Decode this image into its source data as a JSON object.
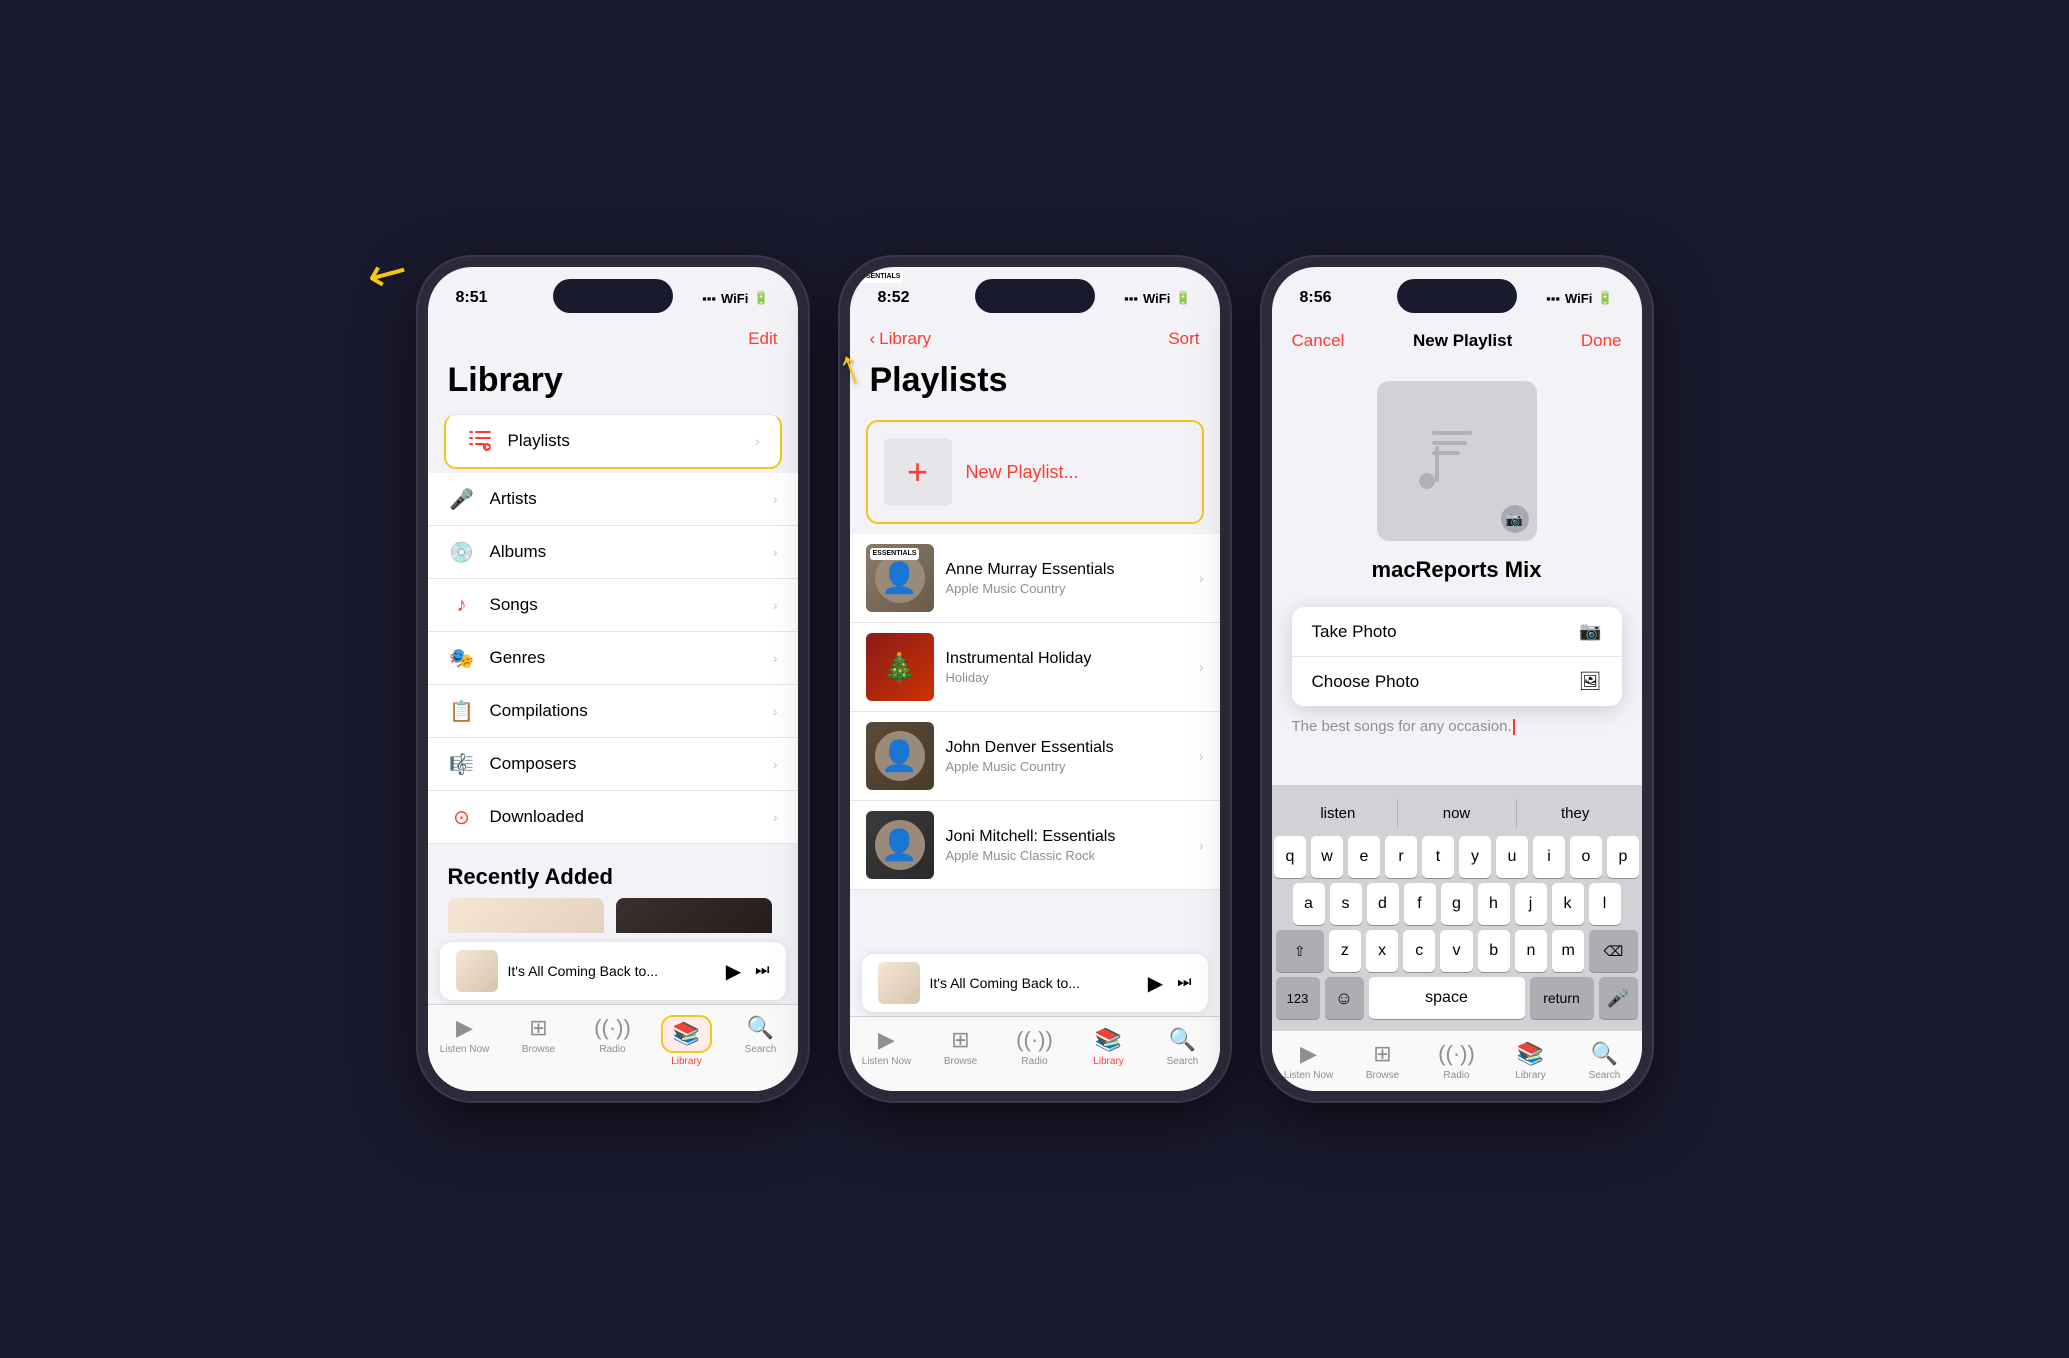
{
  "phone1": {
    "status_time": "8:51",
    "nav_action": "Edit",
    "page_title": "Library",
    "library_items": [
      {
        "icon": "🎵",
        "label": "Playlists",
        "highlighted": true
      },
      {
        "icon": "🎤",
        "label": "Artists"
      },
      {
        "icon": "💿",
        "label": "Albums"
      },
      {
        "icon": "♪",
        "label": "Songs"
      },
      {
        "icon": "🎭",
        "label": "Genres"
      },
      {
        "icon": "📋",
        "label": "Compilations"
      },
      {
        "icon": "🎼",
        "label": "Composers"
      },
      {
        "icon": "⬇",
        "label": "Downloaded"
      }
    ],
    "section_recently_added": "Recently Added",
    "now_playing_title": "It's All Coming Back to...",
    "tabs": [
      {
        "icon": "▶",
        "label": "Listen Now"
      },
      {
        "icon": "⊞",
        "label": "Browse"
      },
      {
        "icon": "📡",
        "label": "Radio"
      },
      {
        "icon": "📚",
        "label": "Library",
        "active": true
      },
      {
        "icon": "🔍",
        "label": "Search"
      }
    ]
  },
  "phone2": {
    "status_time": "8:52",
    "nav_back": "Library",
    "nav_action": "Sort",
    "page_title": "Playlists",
    "new_playlist_label": "New Playlist...",
    "playlists": [
      {
        "name": "Anne Murray Essentials",
        "sub": "Apple Music Country",
        "type": "anne"
      },
      {
        "name": "Instrumental Holiday",
        "sub": "Holiday",
        "type": "instrumental"
      },
      {
        "name": "John Denver Essentials",
        "sub": "Apple Music Country",
        "type": "john"
      },
      {
        "name": "Joni Mitchell: Essentials",
        "sub": "Apple Music Classic Rock",
        "type": "joni"
      }
    ],
    "now_playing_title": "It's All Coming Back to...",
    "tabs": [
      {
        "icon": "▶",
        "label": "Listen Now"
      },
      {
        "icon": "⊞",
        "label": "Browse"
      },
      {
        "icon": "📡",
        "label": "Radio"
      },
      {
        "icon": "📚",
        "label": "Library",
        "active": true
      },
      {
        "icon": "🔍",
        "label": "Search"
      }
    ]
  },
  "phone3": {
    "status_time": "8:56",
    "nav_cancel": "Cancel",
    "nav_title": "New Playlist",
    "nav_done": "Done",
    "playlist_name": "macReports Mix",
    "description": "The best songs for any occasion.",
    "photo_menu": {
      "take_photo": "Take Photo",
      "choose_photo": "Choose Photo"
    },
    "suggestions": [
      "listen",
      "now",
      "they"
    ],
    "keyboard_rows": [
      [
        "q",
        "w",
        "e",
        "r",
        "t",
        "y",
        "u",
        "i",
        "o",
        "p"
      ],
      [
        "a",
        "s",
        "d",
        "f",
        "g",
        "h",
        "j",
        "k",
        "l"
      ],
      [
        "z",
        "x",
        "c",
        "v",
        "b",
        "n",
        "m"
      ],
      [
        "123",
        "space",
        "return"
      ]
    ],
    "tabs": [
      {
        "icon": "▶",
        "label": "Listen Now"
      },
      {
        "icon": "⊞",
        "label": "Browse"
      },
      {
        "icon": "📡",
        "label": "Radio"
      },
      {
        "icon": "📚",
        "label": "Library"
      },
      {
        "icon": "🔍",
        "label": "Search"
      }
    ]
  },
  "colors": {
    "red": "#ff3b30",
    "yellow": "#f5c518",
    "gray": "#8e8e93"
  }
}
